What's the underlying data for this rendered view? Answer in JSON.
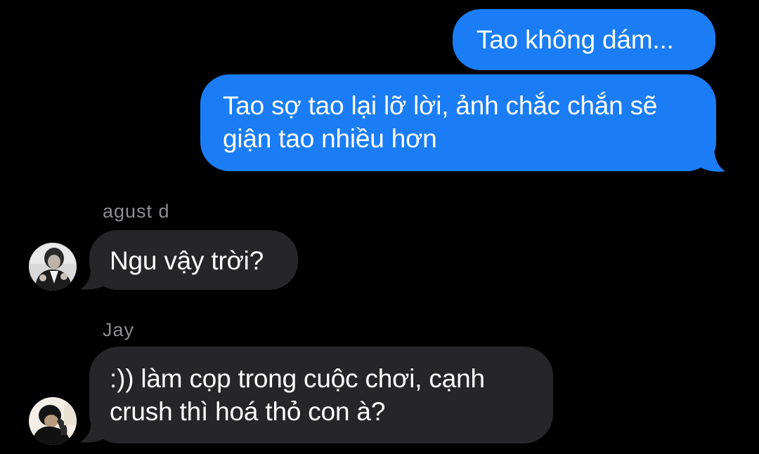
{
  "messages": [
    {
      "id": "m1",
      "direction": "outgoing",
      "lines": [
        "Tao không dám..."
      ]
    },
    {
      "id": "m2",
      "direction": "outgoing",
      "lines": [
        "Tao sợ tao lại lỡ lời, ảnh chắc chắn sẽ",
        "giận tao nhiều hơn"
      ]
    },
    {
      "id": "m3",
      "direction": "incoming",
      "sender": "agust d",
      "lines": [
        "Ngu vậy trời?"
      ]
    },
    {
      "id": "m4",
      "direction": "incoming",
      "sender": "Jay",
      "lines": [
        ":)) làm cọp trong cuộc chơi, cạnh",
        "crush thì hoá thỏ con à?"
      ]
    }
  ],
  "colors": {
    "background": "#000000",
    "outgoing_bubble": "#1a7df5",
    "incoming_bubble": "#262628",
    "sender_name": "#8e8e93",
    "text": "#ffffff"
  },
  "icons": {
    "avatar_1": "avatar-photo",
    "avatar_2": "avatar-photo"
  }
}
